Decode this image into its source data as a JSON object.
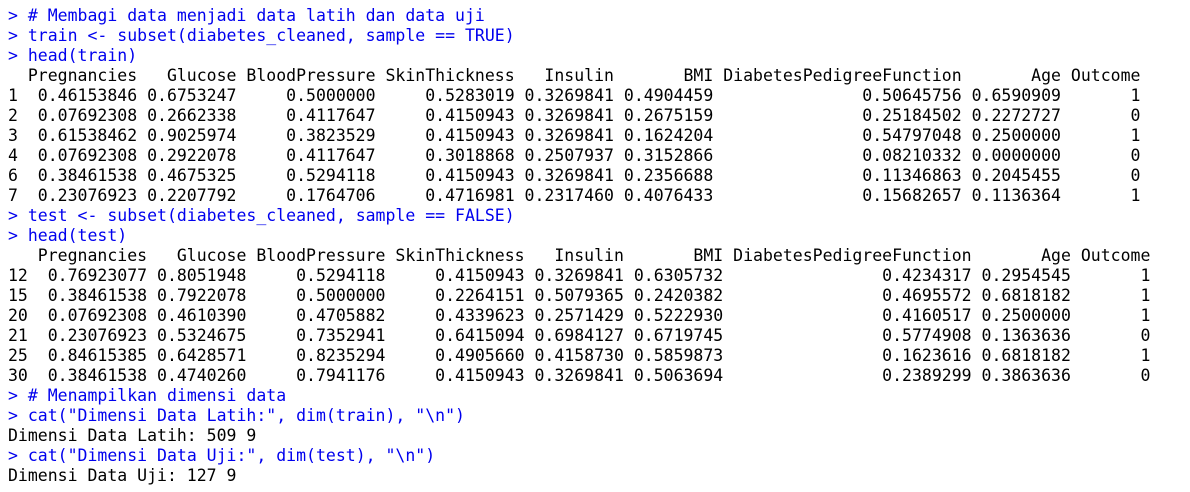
{
  "console": {
    "lines": [
      {
        "type": "cmd",
        "prompt": "> ",
        "text": "# Membagi data menjadi data latih dan data uji"
      },
      {
        "type": "cmd",
        "prompt": "> ",
        "text": "train <- subset(diabetes_cleaned, sample == TRUE)"
      },
      {
        "type": "cmd",
        "prompt": "> ",
        "text": "head(train)"
      },
      {
        "type": "out",
        "text": "  Pregnancies   Glucose BloodPressure SkinThickness   Insulin       BMI DiabetesPedigreeFunction       Age Outcome"
      },
      {
        "type": "out",
        "text": "1  0.46153846 0.6753247     0.5000000     0.5283019 0.3269841 0.4904459               0.50645756 0.6590909       1"
      },
      {
        "type": "out",
        "text": "2  0.07692308 0.2662338     0.4117647     0.4150943 0.3269841 0.2675159               0.25184502 0.2272727       0"
      },
      {
        "type": "out",
        "text": "3  0.61538462 0.9025974     0.3823529     0.4150943 0.3269841 0.1624204               0.54797048 0.2500000       1"
      },
      {
        "type": "out",
        "text": "4  0.07692308 0.2922078     0.4117647     0.3018868 0.2507937 0.3152866               0.08210332 0.0000000       0"
      },
      {
        "type": "out",
        "text": "6  0.38461538 0.4675325     0.5294118     0.4150943 0.3269841 0.2356688               0.11346863 0.2045455       0"
      },
      {
        "type": "out",
        "text": "7  0.23076923 0.2207792     0.1764706     0.4716981 0.2317460 0.4076433               0.15682657 0.1136364       1"
      },
      {
        "type": "cmd",
        "prompt": "> ",
        "text": "test <- subset(diabetes_cleaned, sample == FALSE)"
      },
      {
        "type": "cmd",
        "prompt": "> ",
        "text": "head(test)"
      },
      {
        "type": "out",
        "text": "   Pregnancies   Glucose BloodPressure SkinThickness   Insulin       BMI DiabetesPedigreeFunction       Age Outcome"
      },
      {
        "type": "out",
        "text": "12  0.76923077 0.8051948     0.5294118     0.4150943 0.3269841 0.6305732                0.4234317 0.2954545       1"
      },
      {
        "type": "out",
        "text": "15  0.38461538 0.7922078     0.5000000     0.2264151 0.5079365 0.2420382                0.4695572 0.6818182       1"
      },
      {
        "type": "out",
        "text": "20  0.07692308 0.4610390     0.4705882     0.4339623 0.2571429 0.5222930                0.4160517 0.2500000       1"
      },
      {
        "type": "out",
        "text": "21  0.23076923 0.5324675     0.7352941     0.6415094 0.6984127 0.6719745                0.5774908 0.1363636       0"
      },
      {
        "type": "out",
        "text": "25  0.84615385 0.6428571     0.8235294     0.4905660 0.4158730 0.5859873                0.1623616 0.6818182       1"
      },
      {
        "type": "out",
        "text": "30  0.38461538 0.4740260     0.7941176     0.4150943 0.3269841 0.5063694                0.2389299 0.3863636       0"
      },
      {
        "type": "cmd",
        "prompt": "> ",
        "text": "# Menampilkan dimensi data"
      },
      {
        "type": "cmd",
        "prompt": "> ",
        "text": "cat(\"Dimensi Data Latih:\", dim(train), \"\\n\")"
      },
      {
        "type": "out",
        "text": "Dimensi Data Latih: 509 9"
      },
      {
        "type": "cmd",
        "prompt": "> ",
        "text": "cat(\"Dimensi Data Uji:\", dim(test), \"\\n\")"
      },
      {
        "type": "out",
        "text": "Dimensi Data Uji: 127 9"
      }
    ]
  }
}
